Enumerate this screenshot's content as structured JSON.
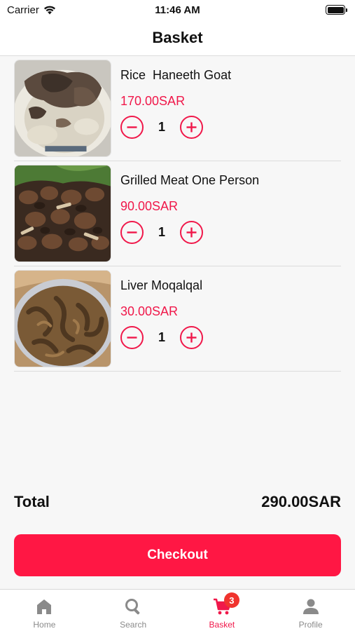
{
  "status_bar": {
    "carrier": "Carrier",
    "time": "11:46 AM"
  },
  "nav": {
    "title": "Basket"
  },
  "items": [
    {
      "name": "Rice  Haneeth Goat",
      "price": "170.00SAR",
      "quantity": "1"
    },
    {
      "name": "Grilled Meat One Person",
      "price": "90.00SAR",
      "quantity": "1"
    },
    {
      "name": "Liver Moqalqal",
      "price": "30.00SAR",
      "quantity": "1"
    }
  ],
  "summary": {
    "total_label": "Total",
    "total_value": "290.00SAR"
  },
  "checkout": {
    "label": "Checkout"
  },
  "tabs": [
    {
      "label": "Home",
      "icon": "home-icon"
    },
    {
      "label": "Search",
      "icon": "search-icon"
    },
    {
      "label": "Basket",
      "icon": "cart-icon",
      "badge": "3"
    },
    {
      "label": "Profile",
      "icon": "profile-icon"
    }
  ],
  "colors": {
    "accent": "#f0184a",
    "checkout_bg": "#ff1744",
    "inactive_tab": "#8a8a8a"
  }
}
